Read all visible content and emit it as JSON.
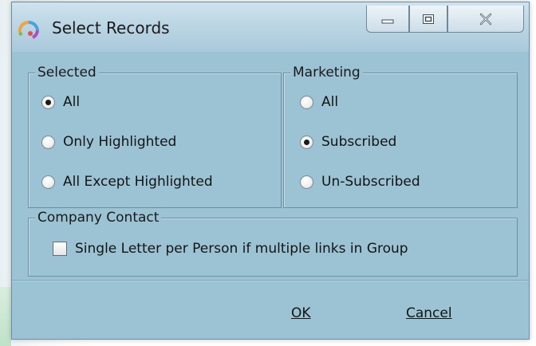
{
  "window": {
    "title": "Select Records",
    "controls": {
      "minimize": "minimize",
      "maximize": "maximize",
      "close": "close"
    }
  },
  "selected_group": {
    "legend": "Selected",
    "options": [
      {
        "label": "All",
        "checked": true
      },
      {
        "label": "Only Highlighted",
        "checked": false
      },
      {
        "label": "All Except Highlighted",
        "checked": false
      }
    ]
  },
  "marketing_group": {
    "legend": "Marketing",
    "options": [
      {
        "label": "All",
        "checked": false
      },
      {
        "label": "Subscribed",
        "checked": true
      },
      {
        "label": "Un-Subscribed",
        "checked": false
      }
    ]
  },
  "company_contact_group": {
    "legend": "Company Contact",
    "checkbox_label": "Single Letter per Person if multiple links in Group",
    "checkbox_checked": false
  },
  "buttons": {
    "ok": "OK",
    "cancel": "Cancel"
  },
  "colors": {
    "dialog_bg": "#9cc3d4",
    "titlebar": "#bcd6e4",
    "border": "#6d8fa0"
  },
  "icons": [
    "app-logo-icon",
    "minimize-icon",
    "maximize-icon",
    "close-icon"
  ]
}
